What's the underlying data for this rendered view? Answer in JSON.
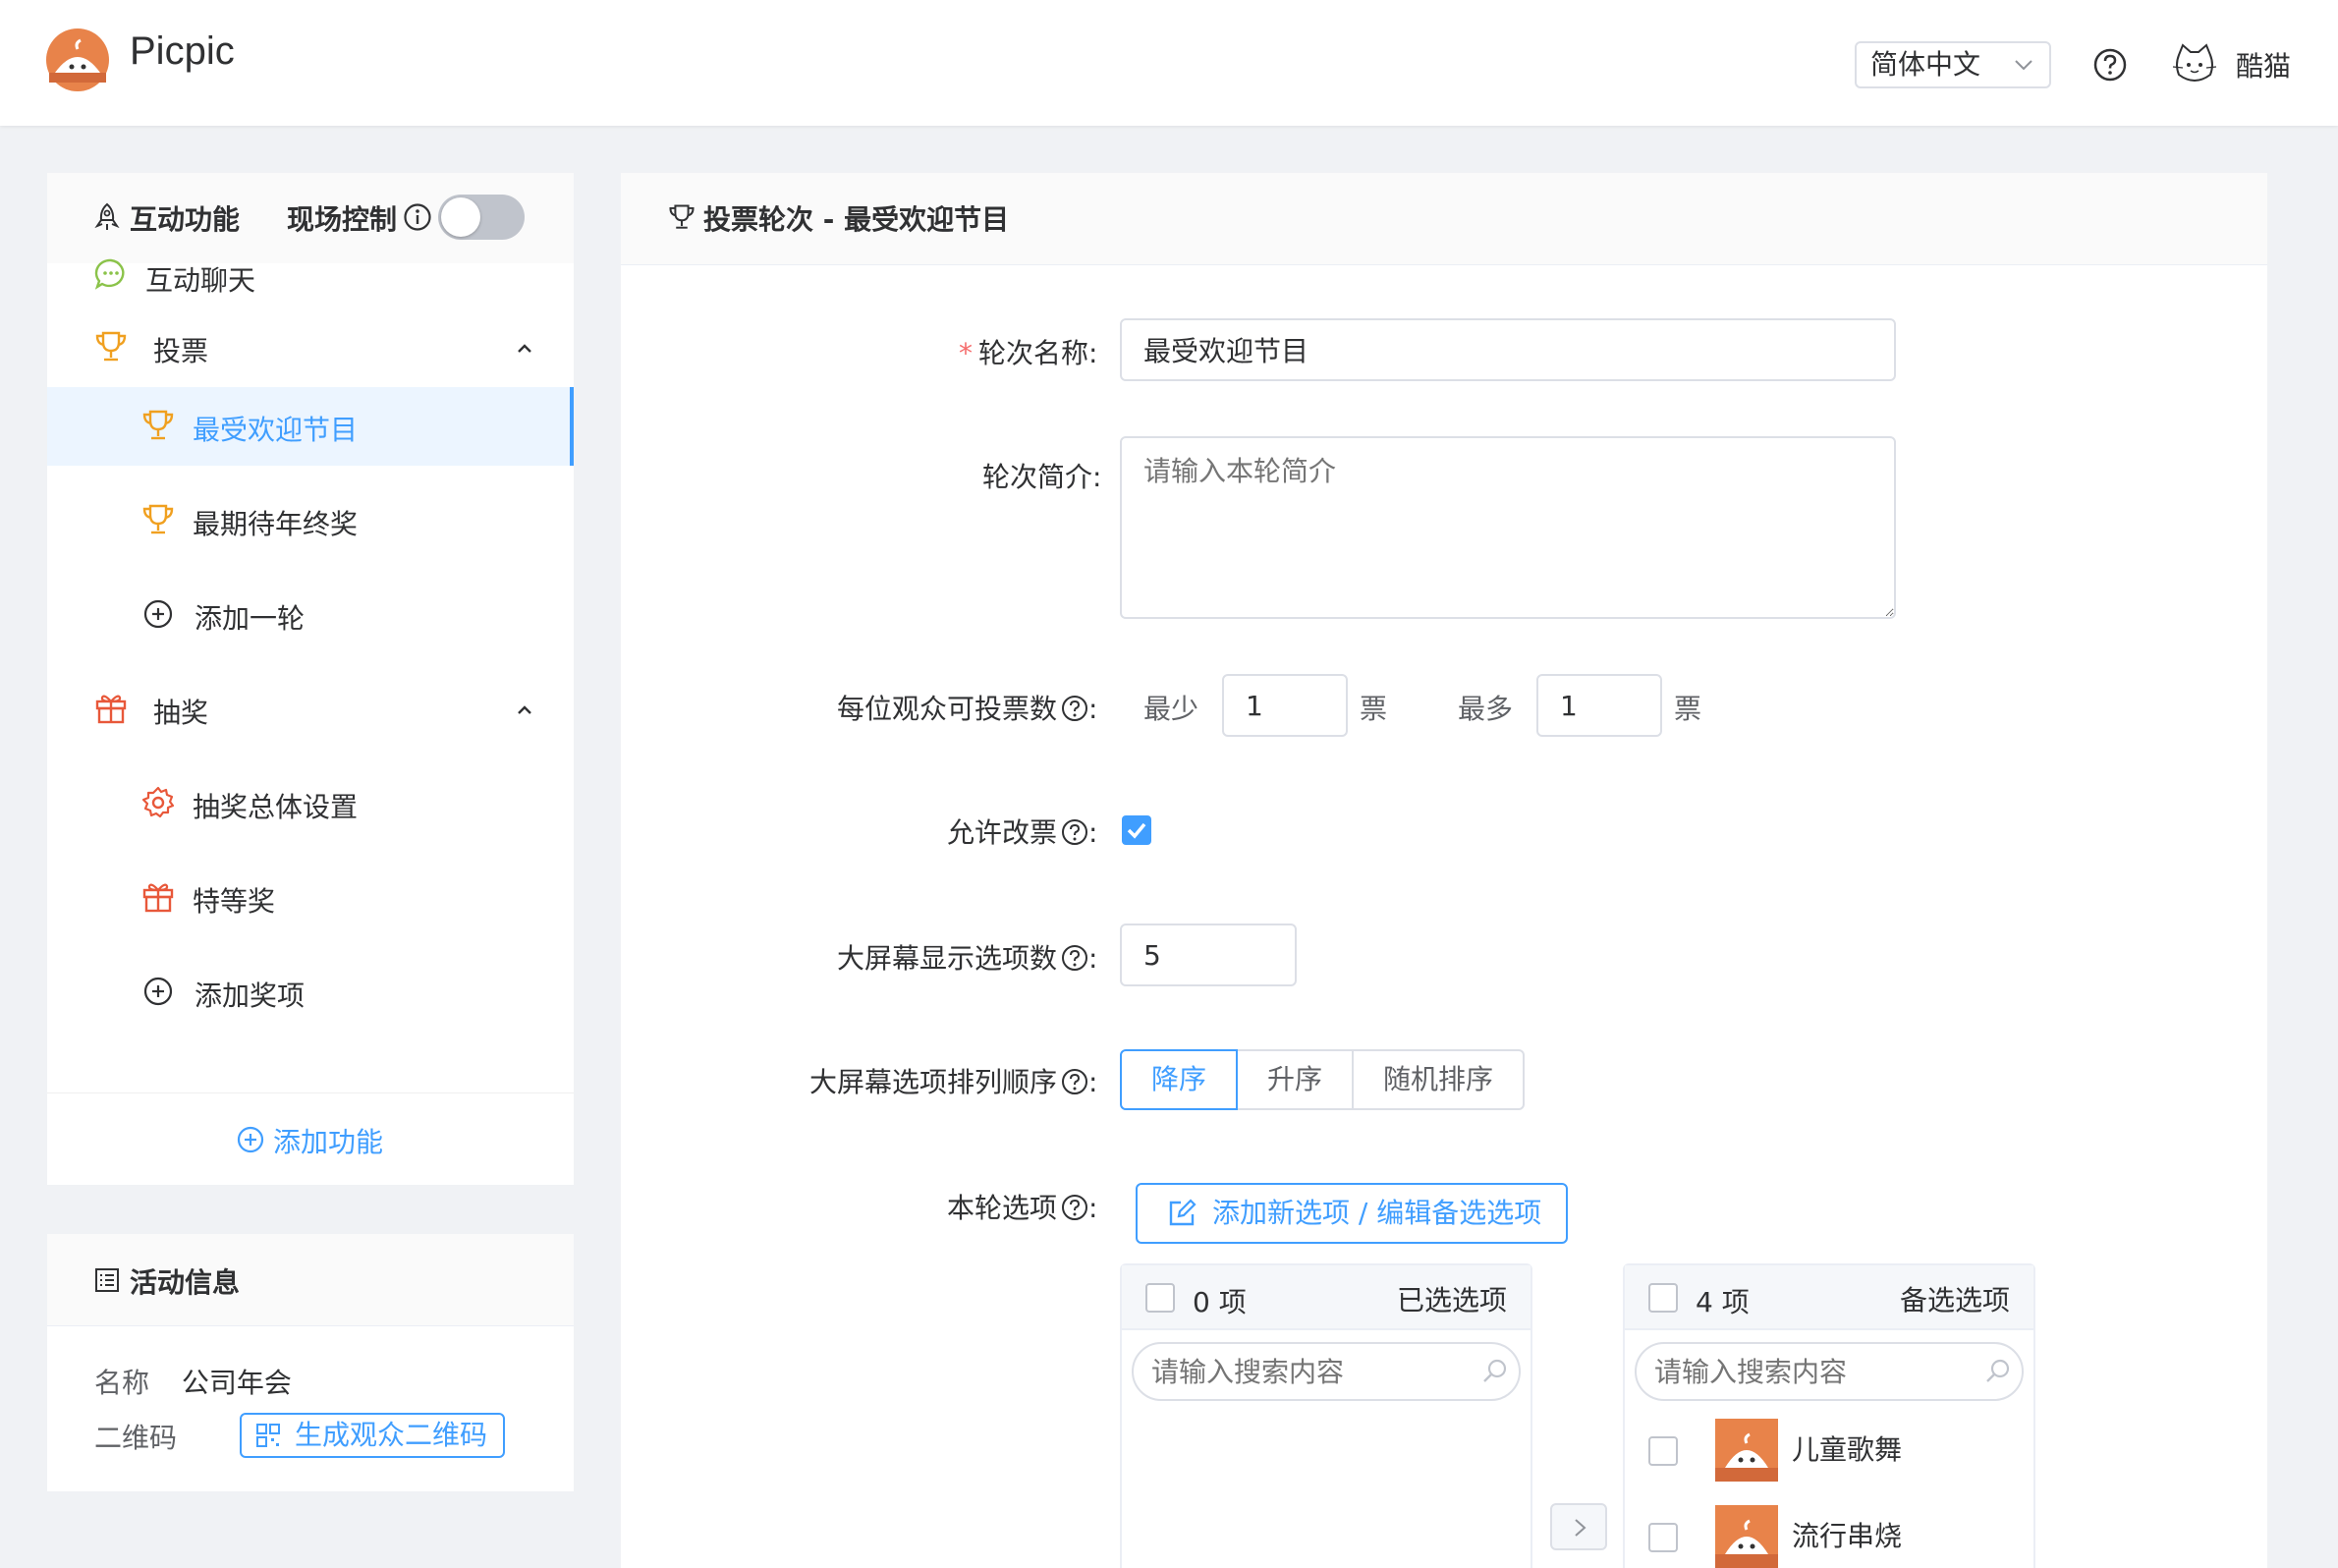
{
  "header": {
    "brand": "Picpic",
    "language": "简体中文",
    "username": "酷猫"
  },
  "sidebar": {
    "section_title": "互动功能",
    "live_control_label": "现场控制",
    "live_control_on": false,
    "items": [
      {
        "label": "互动聊天",
        "icon": "chat-bubble-icon"
      },
      {
        "label": "投票",
        "icon": "trophy-icon",
        "expanded": true
      },
      {
        "label": "最受欢迎节目",
        "icon": "trophy-icon",
        "active": true
      },
      {
        "label": "最期待年终奖",
        "icon": "trophy-icon"
      },
      {
        "label": "添加一轮",
        "icon": "plus-circle-icon"
      },
      {
        "label": "抽奖",
        "icon": "gift-icon",
        "expanded": true
      },
      {
        "label": "抽奖总体设置",
        "icon": "gear-icon"
      },
      {
        "label": "特等奖",
        "icon": "gift-icon"
      },
      {
        "label": "添加奖项",
        "icon": "plus-circle-icon"
      }
    ],
    "add_function_label": "添加功能"
  },
  "activity_info": {
    "title": "活动信息",
    "name_label": "名称",
    "name_value": "公司年会",
    "qr_label": "二维码",
    "qr_button": "生成观众二维码"
  },
  "main": {
    "title": "投票轮次 - 最受欢迎节目",
    "form": {
      "round_name_label": "轮次名称:",
      "round_name_value": "最受欢迎节目",
      "intro_label": "轮次简介:",
      "intro_placeholder": "请输入本轮简介",
      "votes_label": "每位观众可投票数",
      "votes_min_label": "最少",
      "votes_min_value": "1",
      "votes_max_label": "最多",
      "votes_max_value": "1",
      "votes_unit": "票",
      "allow_change_label": "允许改票",
      "allow_change_checked": true,
      "screen_count_label": "大屏幕显示选项数",
      "screen_count_value": "5",
      "screen_order_label": "大屏幕选项排列顺序",
      "order_options": [
        "降序",
        "升序",
        "随机排序"
      ],
      "order_selected": "降序",
      "options_label": "本轮选项",
      "add_option_button": "添加新选项 / 编辑备选选项"
    },
    "transfer": {
      "left": {
        "count": "0 项",
        "title": "已选选项",
        "search_placeholder": "请输入搜索内容",
        "items": []
      },
      "right": {
        "count": "4 项",
        "title": "备选选项",
        "search_placeholder": "请输入搜索内容",
        "items": [
          {
            "name": "儿童歌舞"
          },
          {
            "name": "流行串烧"
          }
        ]
      }
    }
  },
  "colors": {
    "primary": "#409eff",
    "brand_orange": "#e8834a",
    "required": "#f56c6c"
  }
}
